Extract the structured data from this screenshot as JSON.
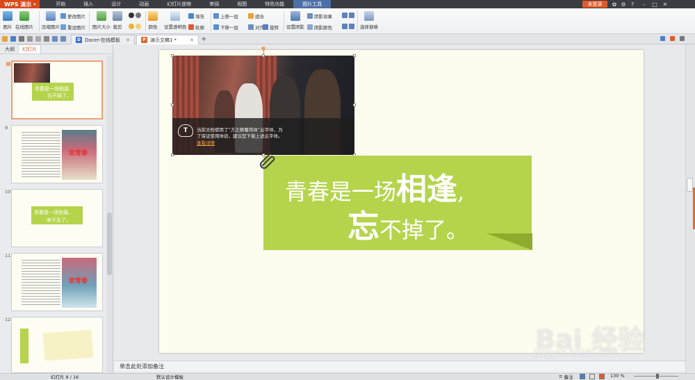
{
  "app": {
    "logo": "WPS 演示",
    "login": "未登录"
  },
  "menu": [
    {
      "label": "开始"
    },
    {
      "label": "插入"
    },
    {
      "label": "设计"
    },
    {
      "label": "动画"
    },
    {
      "label": "幻灯片放映"
    },
    {
      "label": "审阅"
    },
    {
      "label": "视图"
    },
    {
      "label": "特色功能"
    },
    {
      "label": "图片工具"
    }
  ],
  "ribbon": {
    "picture": "图片",
    "online_picture": "在线图片",
    "compress": "压缩图片",
    "change_picture": "更改图片",
    "reset_picture": "重设图片",
    "picture_size": "图片大小",
    "crop": "裁剪",
    "color": "颜色",
    "set_transparent": "设置透明色",
    "fill": "填充",
    "outline": "轮廓",
    "bring_forward": "上移一层",
    "send_backward": "下移一层",
    "group": "组合",
    "align": "对齐",
    "rotate": "旋转",
    "shadow_set": "设置阴影",
    "shadow_effect": "阴影效果",
    "shadow_color": "阴影颜色",
    "select_pane": "选择窗格"
  },
  "tabs": {
    "docer": "Docer-在线模板",
    "doc": "演示文稿1 *"
  },
  "panel": {
    "tab_outline": "大纲",
    "tab_slides": "幻灯片",
    "slides": [
      {
        "num": "9"
      },
      {
        "num": "10"
      },
      {
        "num": "11"
      },
      {
        "num": "12"
      }
    ],
    "thumb8_line1": "青春是一场相逢,",
    "thumb8_line2": "忘不掉了。",
    "thumb10_line1": "青春是一场伤痛,",
    "thumb10_line2": "来不及了。",
    "thumb_caption": "致青春"
  },
  "slide": {
    "notice_line1": "当前文档使用了“方正静蕾简体”云字体，为",
    "notice_line2": "了保证使用体验，建议您下载上述云字体。",
    "notice_link": "查看详情",
    "text1_a": "青春是一场",
    "text1_b": "相逢",
    "text1_c": ",",
    "text2_a": "忘",
    "text2_b": "不掉了。"
  },
  "notes": "单击此处添加备注",
  "status": {
    "slide": "幻灯片 8 / 16",
    "template": "默认设计模板",
    "notes": "备注",
    "zoom": "130 %"
  },
  "watermark": {
    "logo": "Bai 经验",
    "url": "jingyan.baidu.com"
  },
  "colors": {
    "accent": "#d84a1b",
    "green": "#b5d44c",
    "tool_tab": "#4d6fa8"
  }
}
